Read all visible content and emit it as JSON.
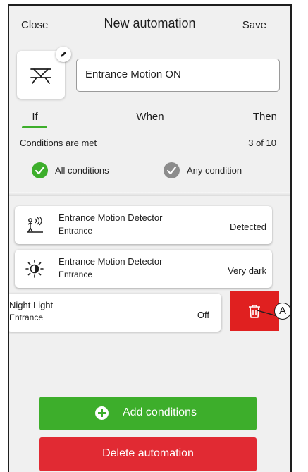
{
  "header": {
    "close_label": "Close",
    "title": "New automation",
    "save_label": "Save"
  },
  "automation": {
    "icon": "scene-lamp-icon",
    "name": "Entrance Motion ON"
  },
  "tabs": [
    {
      "label": "If",
      "active": true
    },
    {
      "label": "When",
      "active": false
    },
    {
      "label": "Then",
      "active": false
    }
  ],
  "conditions": {
    "label": "Conditions are met",
    "count": "3 of 10",
    "options": [
      {
        "label": "All conditions",
        "selected": true
      },
      {
        "label": "Any condition",
        "selected": false
      }
    ]
  },
  "condition_items": [
    {
      "title": "Entrance Motion Detector",
      "room": "Entrance",
      "value": "Detected",
      "icon": "motion-sensor-icon"
    },
    {
      "title": "Entrance Motion Detector",
      "room": "Entrance",
      "value": "Very dark",
      "icon": "brightness-icon"
    },
    {
      "title": "Night Light",
      "room": "Entrance",
      "value": "Off",
      "icon": ""
    }
  ],
  "swipe_action": {
    "icon": "trash-icon"
  },
  "callout": {
    "label": "A"
  },
  "buttons": {
    "add_label": "Add conditions",
    "delete_label": "Delete automation"
  },
  "colors": {
    "accent_green": "#3dae2b",
    "danger_red": "#e02020",
    "delete_button_red": "#e12a33",
    "radio_unselected": "#8c8c8c"
  }
}
